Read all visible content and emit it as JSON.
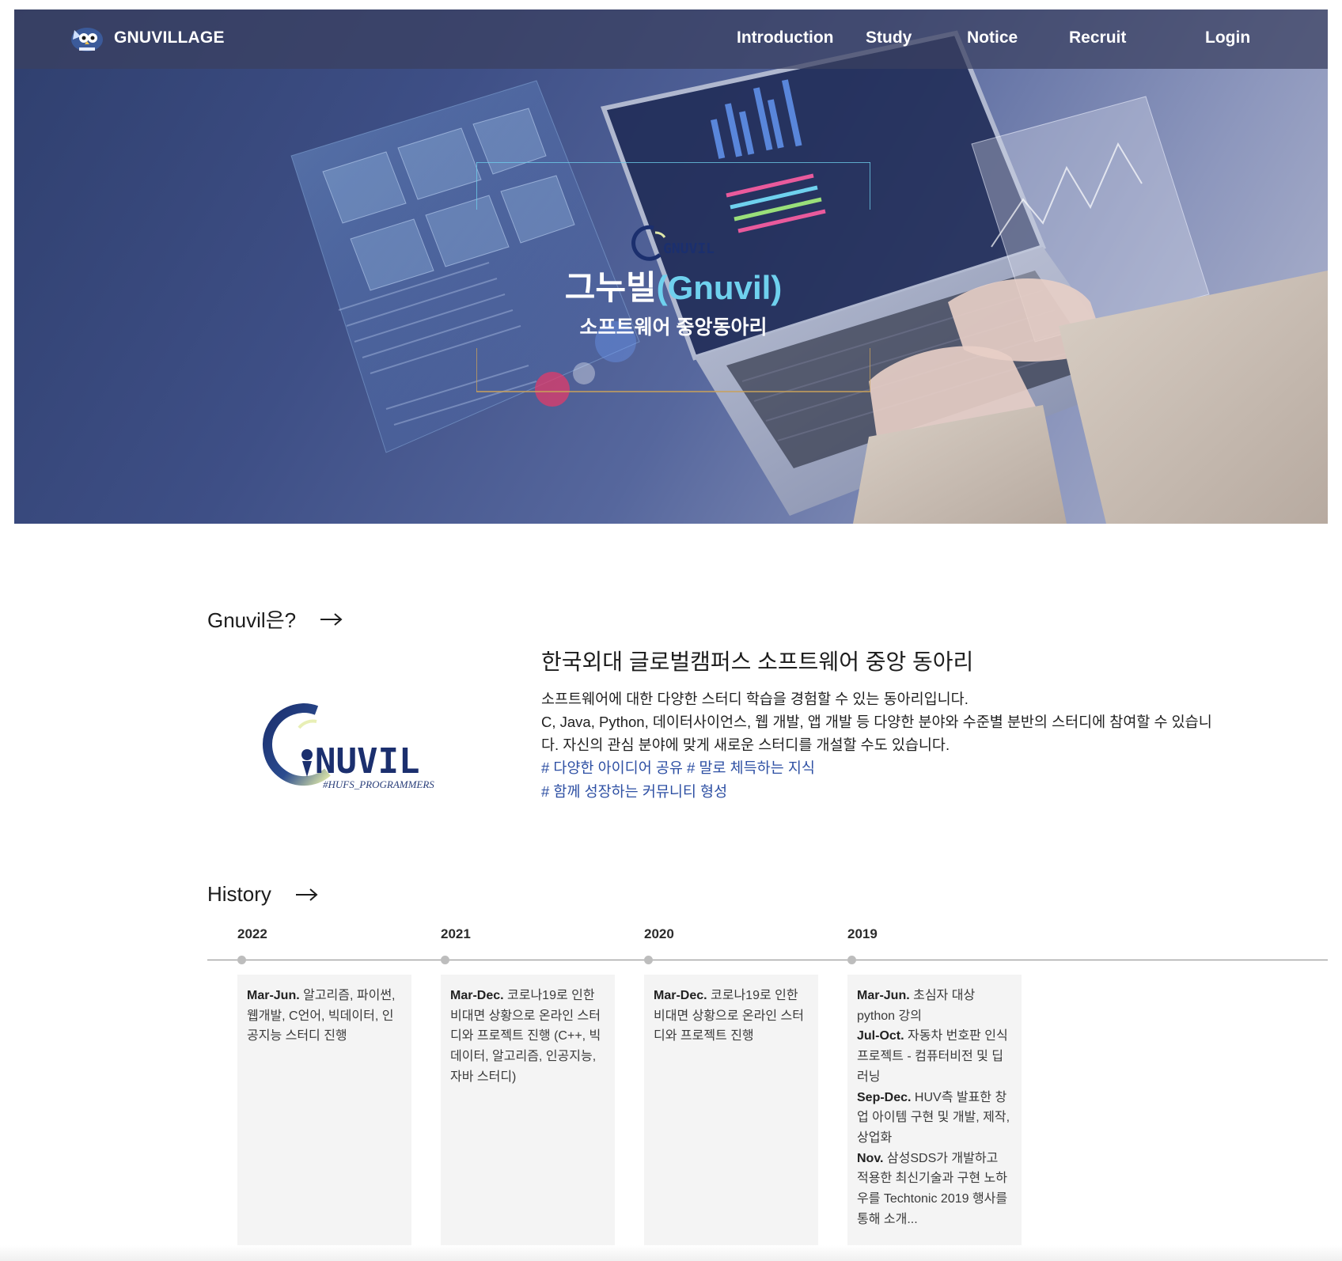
{
  "navbar": {
    "brand": "GNUVILLAGE",
    "items": [
      "Introduction",
      "Study",
      "Notice",
      "Recruit",
      "Login"
    ]
  },
  "hero": {
    "title_main": "그누빌",
    "title_accent": "(Gnuvil)",
    "subtitle": "소프트웨어 중앙동아리",
    "mini_logo_text": "GNUVIL"
  },
  "intro": {
    "section_title": "Gnuvil은?",
    "logo": {
      "text": "NUVIL",
      "caption": "#HUFS_PROGRAMMERS"
    },
    "heading": "한국외대 글로벌캠퍼스 소프트웨어 중앙 동아리",
    "lines": [
      "소프트웨어에 대한 다양한 스터디 학습을 경험할 수 있는 동아리입니다.",
      "C, Java, Python, 데이터사이언스, 웹 개발, 앱 개발 등 다양한 분야와 수준별 분반의 스터디에 참여할 수 있습니다. 자신의 관심 분야에 맞게 새로운 스터디를 개설할 수도 있습니다."
    ],
    "tags": [
      "# 다양한 아이디어 공유 # 말로 체득하는 지식",
      "# 함께 성장하는 커뮤니티 형성"
    ]
  },
  "history": {
    "section_title": "History",
    "years": [
      {
        "year": "2022",
        "entries": [
          {
            "period": "Mar-Jun.",
            "text": " 알고리즘, 파이썬, 웹개발, C언어, 빅데이터, 인공지능 스터디 진행"
          }
        ]
      },
      {
        "year": "2021",
        "entries": [
          {
            "period": "Mar-Dec.",
            "text": " 코로나19로 인한 비대면 상황으로 온라인 스터디와 프로젝트 진행 (C++, 빅데이터, 알고리즘, 인공지능, 자바 스터디)"
          }
        ]
      },
      {
        "year": "2020",
        "entries": [
          {
            "period": "Mar-Dec.",
            "text": " 코로나19로 인한 비대면 상황으로 온라인 스터디와 프로젝트 진행"
          }
        ]
      },
      {
        "year": "2019",
        "entries": [
          {
            "period": "Mar-Jun.",
            "text": " 초심자 대상 python 강의"
          },
          {
            "period": "Jul-Oct.",
            "text": " 자동차 번호판 인식 프로젝트 - 컴퓨터비전 및 딥러닝"
          },
          {
            "period": "Sep-Dec.",
            "text": " HUV측 발표한 창업 아이템 구현 및 개발, 제작, 상업화"
          },
          {
            "period": "Nov.",
            "text": " 삼성SDS가 개발하고 적용한 최신기술과 구현 노하우를 Techtonic 2019 행사를 통해 소개..."
          }
        ]
      }
    ]
  },
  "colors": {
    "nav_bg": "#3a4060",
    "accent_cyan": "#6fd1ee",
    "tag_blue": "#2d4fa3",
    "card_bg": "#f4f4f4",
    "logo_navy": "#1b2f6e"
  },
  "icons": [
    "owl-logo-icon",
    "gnuvil-logo-icon",
    "arrow-right-icon",
    "timeline-dot-icon"
  ]
}
